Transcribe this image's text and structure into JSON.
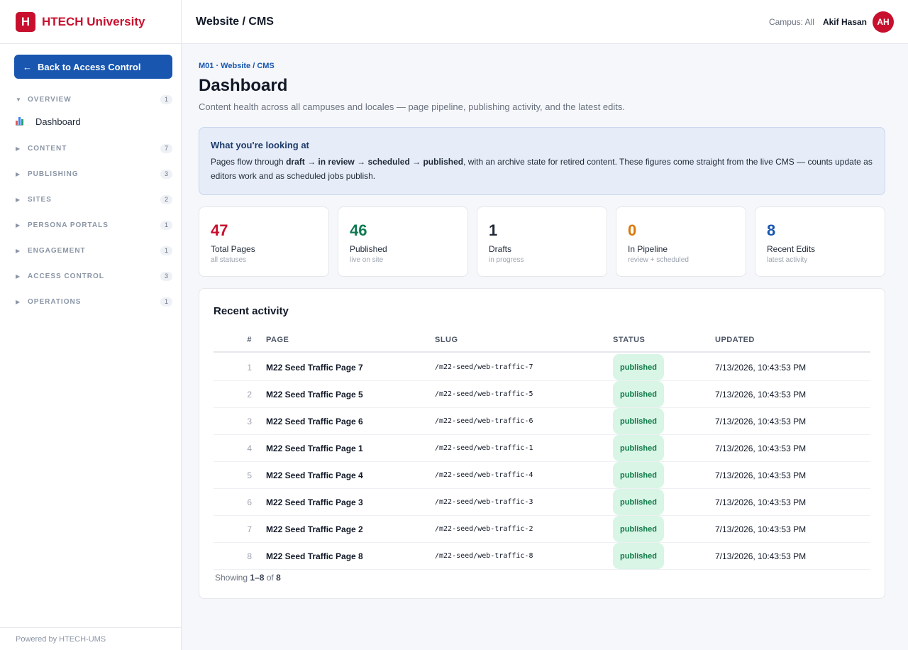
{
  "brand": {
    "logo_letter": "H",
    "name": "HTECH University",
    "color": "#c8102e"
  },
  "sidebar": {
    "back_label": "Back to Access Control",
    "back_arrow": "←",
    "groups": [
      {
        "label": "OVERVIEW",
        "count": "1",
        "expanded": true
      },
      {
        "label": "CONTENT",
        "count": "7",
        "expanded": false
      },
      {
        "label": "PUBLISHING",
        "count": "3",
        "expanded": false
      },
      {
        "label": "SITES",
        "count": "2",
        "expanded": false
      },
      {
        "label": "PERSONA PORTALS",
        "count": "1",
        "expanded": false
      },
      {
        "label": "ENGAGEMENT",
        "count": "1",
        "expanded": false
      },
      {
        "label": "ACCESS CONTROL",
        "count": "3",
        "expanded": false
      },
      {
        "label": "OPERATIONS",
        "count": "1",
        "expanded": false
      }
    ],
    "active_item": {
      "label": "Dashboard",
      "icon": "bar-chart-icon"
    },
    "footer": "Powered by HTECH-UMS"
  },
  "header": {
    "title": "Website / CMS",
    "campus": "Campus: All",
    "user": "Akif Hasan",
    "avatar_initials": "AH"
  },
  "main": {
    "breadcrumb": "M01 · Website / CMS",
    "title": "Dashboard",
    "subtitle": "Content health across all campuses and locales — page pipeline, publishing activity, and the latest edits.",
    "info": {
      "heading": "What you're looking at",
      "text_1": "Pages flow through ",
      "flow": "draft → in review → scheduled → published",
      "text_2": ", with an archive state for retired content. These figures come straight from the live CMS — counts update as editors work and as scheduled jobs publish."
    },
    "stats": [
      {
        "value": "47",
        "label": "Total Pages",
        "sub": "all statuses",
        "color": "#c8102e"
      },
      {
        "value": "46",
        "label": "Published",
        "sub": "live on site",
        "color": "#0f7a52"
      },
      {
        "value": "1",
        "label": "Drafts",
        "sub": "in progress",
        "color": "#1f2937"
      },
      {
        "value": "0",
        "label": "In Pipeline",
        "sub": "review + scheduled",
        "color": "#d97706"
      },
      {
        "value": "8",
        "label": "Recent Edits",
        "sub": "latest activity",
        "color": "#1856b0"
      }
    ],
    "activity": {
      "title": "Recent activity",
      "columns": {
        "num": "#",
        "page": "PAGE",
        "slug": "SLUG",
        "status": "STATUS",
        "updated": "UPDATED"
      },
      "rows": [
        {
          "num": "1",
          "page": "M22 Seed Traffic Page 7",
          "slug": "/m22-seed/web-traffic-7",
          "status": "published",
          "updated": "7/13/2026, 10:43:53 PM"
        },
        {
          "num": "2",
          "page": "M22 Seed Traffic Page 5",
          "slug": "/m22-seed/web-traffic-5",
          "status": "published",
          "updated": "7/13/2026, 10:43:53 PM"
        },
        {
          "num": "3",
          "page": "M22 Seed Traffic Page 6",
          "slug": "/m22-seed/web-traffic-6",
          "status": "published",
          "updated": "7/13/2026, 10:43:53 PM"
        },
        {
          "num": "4",
          "page": "M22 Seed Traffic Page 1",
          "slug": "/m22-seed/web-traffic-1",
          "status": "published",
          "updated": "7/13/2026, 10:43:53 PM"
        },
        {
          "num": "5",
          "page": "M22 Seed Traffic Page 4",
          "slug": "/m22-seed/web-traffic-4",
          "status": "published",
          "updated": "7/13/2026, 10:43:53 PM"
        },
        {
          "num": "6",
          "page": "M22 Seed Traffic Page 3",
          "slug": "/m22-seed/web-traffic-3",
          "status": "published",
          "updated": "7/13/2026, 10:43:53 PM"
        },
        {
          "num": "7",
          "page": "M22 Seed Traffic Page 2",
          "slug": "/m22-seed/web-traffic-2",
          "status": "published",
          "updated": "7/13/2026, 10:43:53 PM"
        },
        {
          "num": "8",
          "page": "M22 Seed Traffic Page 8",
          "slug": "/m22-seed/web-traffic-8",
          "status": "published",
          "updated": "7/13/2026, 10:43:53 PM"
        }
      ],
      "footer": {
        "prefix": "Showing ",
        "range": "1–8",
        "of": " of ",
        "total": "8"
      }
    }
  }
}
